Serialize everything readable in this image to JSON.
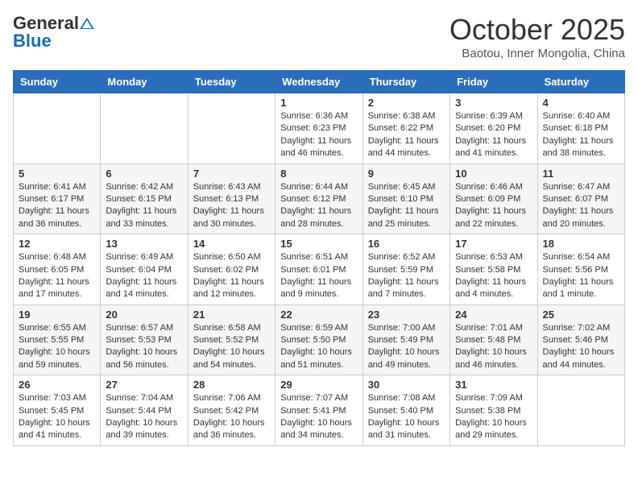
{
  "header": {
    "logo": {
      "general": "General",
      "blue": "Blue"
    },
    "title": "October 2025",
    "subtitle": "Baotou, Inner Mongolia, China"
  },
  "weekdays": [
    "Sunday",
    "Monday",
    "Tuesday",
    "Wednesday",
    "Thursday",
    "Friday",
    "Saturday"
  ],
  "weeks": [
    [
      {
        "day": "",
        "info": ""
      },
      {
        "day": "",
        "info": ""
      },
      {
        "day": "",
        "info": ""
      },
      {
        "day": "1",
        "info": "Sunrise: 6:36 AM\nSunset: 6:23 PM\nDaylight: 11 hours\nand 46 minutes."
      },
      {
        "day": "2",
        "info": "Sunrise: 6:38 AM\nSunset: 6:22 PM\nDaylight: 11 hours\nand 44 minutes."
      },
      {
        "day": "3",
        "info": "Sunrise: 6:39 AM\nSunset: 6:20 PM\nDaylight: 11 hours\nand 41 minutes."
      },
      {
        "day": "4",
        "info": "Sunrise: 6:40 AM\nSunset: 6:18 PM\nDaylight: 11 hours\nand 38 minutes."
      }
    ],
    [
      {
        "day": "5",
        "info": "Sunrise: 6:41 AM\nSunset: 6:17 PM\nDaylight: 11 hours\nand 36 minutes."
      },
      {
        "day": "6",
        "info": "Sunrise: 6:42 AM\nSunset: 6:15 PM\nDaylight: 11 hours\nand 33 minutes."
      },
      {
        "day": "7",
        "info": "Sunrise: 6:43 AM\nSunset: 6:13 PM\nDaylight: 11 hours\nand 30 minutes."
      },
      {
        "day": "8",
        "info": "Sunrise: 6:44 AM\nSunset: 6:12 PM\nDaylight: 11 hours\nand 28 minutes."
      },
      {
        "day": "9",
        "info": "Sunrise: 6:45 AM\nSunset: 6:10 PM\nDaylight: 11 hours\nand 25 minutes."
      },
      {
        "day": "10",
        "info": "Sunrise: 6:46 AM\nSunset: 6:09 PM\nDaylight: 11 hours\nand 22 minutes."
      },
      {
        "day": "11",
        "info": "Sunrise: 6:47 AM\nSunset: 6:07 PM\nDaylight: 11 hours\nand 20 minutes."
      }
    ],
    [
      {
        "day": "12",
        "info": "Sunrise: 6:48 AM\nSunset: 6:05 PM\nDaylight: 11 hours\nand 17 minutes."
      },
      {
        "day": "13",
        "info": "Sunrise: 6:49 AM\nSunset: 6:04 PM\nDaylight: 11 hours\nand 14 minutes."
      },
      {
        "day": "14",
        "info": "Sunrise: 6:50 AM\nSunset: 6:02 PM\nDaylight: 11 hours\nand 12 minutes."
      },
      {
        "day": "15",
        "info": "Sunrise: 6:51 AM\nSunset: 6:01 PM\nDaylight: 11 hours\nand 9 minutes."
      },
      {
        "day": "16",
        "info": "Sunrise: 6:52 AM\nSunset: 5:59 PM\nDaylight: 11 hours\nand 7 minutes."
      },
      {
        "day": "17",
        "info": "Sunrise: 6:53 AM\nSunset: 5:58 PM\nDaylight: 11 hours\nand 4 minutes."
      },
      {
        "day": "18",
        "info": "Sunrise: 6:54 AM\nSunset: 5:56 PM\nDaylight: 11 hours\nand 1 minute."
      }
    ],
    [
      {
        "day": "19",
        "info": "Sunrise: 6:55 AM\nSunset: 5:55 PM\nDaylight: 10 hours\nand 59 minutes."
      },
      {
        "day": "20",
        "info": "Sunrise: 6:57 AM\nSunset: 5:53 PM\nDaylight: 10 hours\nand 56 minutes."
      },
      {
        "day": "21",
        "info": "Sunrise: 6:58 AM\nSunset: 5:52 PM\nDaylight: 10 hours\nand 54 minutes."
      },
      {
        "day": "22",
        "info": "Sunrise: 6:59 AM\nSunset: 5:50 PM\nDaylight: 10 hours\nand 51 minutes."
      },
      {
        "day": "23",
        "info": "Sunrise: 7:00 AM\nSunset: 5:49 PM\nDaylight: 10 hours\nand 49 minutes."
      },
      {
        "day": "24",
        "info": "Sunrise: 7:01 AM\nSunset: 5:48 PM\nDaylight: 10 hours\nand 46 minutes."
      },
      {
        "day": "25",
        "info": "Sunrise: 7:02 AM\nSunset: 5:46 PM\nDaylight: 10 hours\nand 44 minutes."
      }
    ],
    [
      {
        "day": "26",
        "info": "Sunrise: 7:03 AM\nSunset: 5:45 PM\nDaylight: 10 hours\nand 41 minutes."
      },
      {
        "day": "27",
        "info": "Sunrise: 7:04 AM\nSunset: 5:44 PM\nDaylight: 10 hours\nand 39 minutes."
      },
      {
        "day": "28",
        "info": "Sunrise: 7:06 AM\nSunset: 5:42 PM\nDaylight: 10 hours\nand 36 minutes."
      },
      {
        "day": "29",
        "info": "Sunrise: 7:07 AM\nSunset: 5:41 PM\nDaylight: 10 hours\nand 34 minutes."
      },
      {
        "day": "30",
        "info": "Sunrise: 7:08 AM\nSunset: 5:40 PM\nDaylight: 10 hours\nand 31 minutes."
      },
      {
        "day": "31",
        "info": "Sunrise: 7:09 AM\nSunset: 5:38 PM\nDaylight: 10 hours\nand 29 minutes."
      },
      {
        "day": "",
        "info": ""
      }
    ]
  ]
}
